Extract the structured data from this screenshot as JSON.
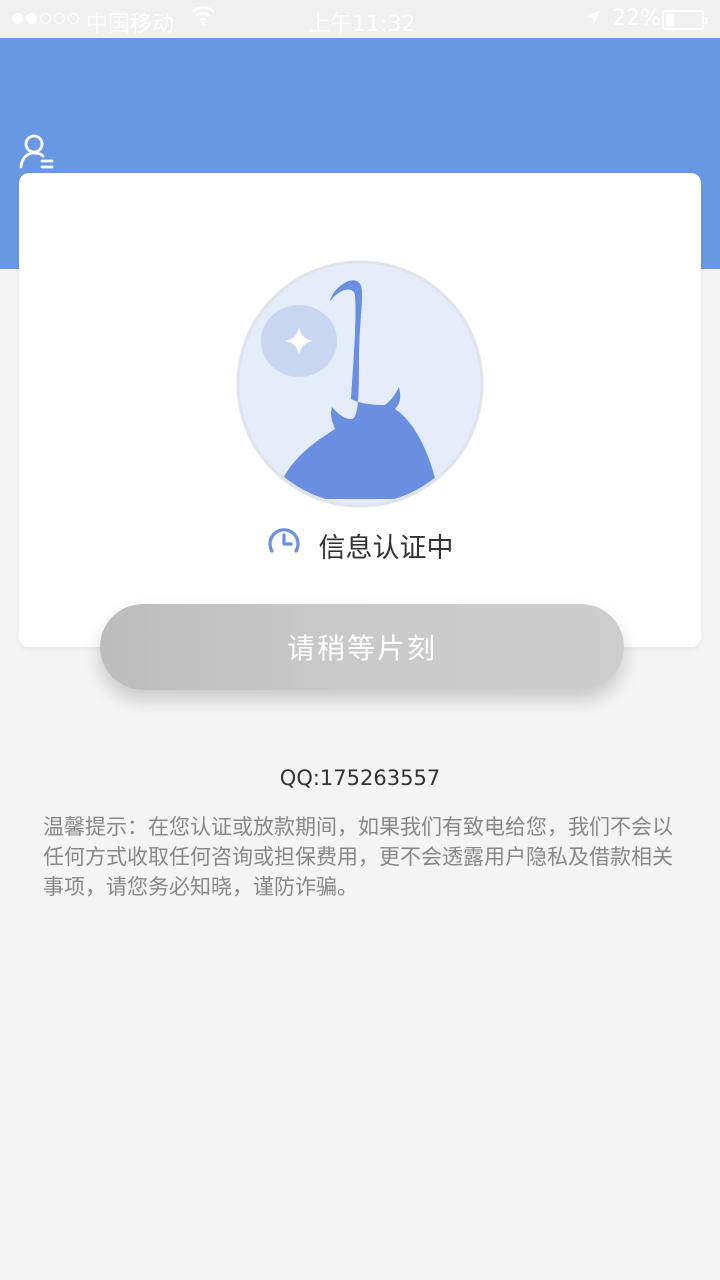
{
  "status_bar": {
    "carrier": "中国移动",
    "time": "上午11:32",
    "battery": "22%"
  },
  "header": {
    "user_icon": "user-list-icon",
    "color": "#6898e2"
  },
  "card": {
    "illustration": "money-bag-icon",
    "status_icon": "clock-icon",
    "status_text": "信息认证中"
  },
  "button": {
    "label": "请稍等片刻"
  },
  "contact": {
    "qq": "QQ:175263557"
  },
  "tip": {
    "text": "温馨提示：在您认证或放款期间，如果我们有致电给您，我们不会以任何方式收取任何咨询或担保费用，更不会透露用户隐私及借款相关事项，请您务必知晓，谨防诈骗。"
  }
}
